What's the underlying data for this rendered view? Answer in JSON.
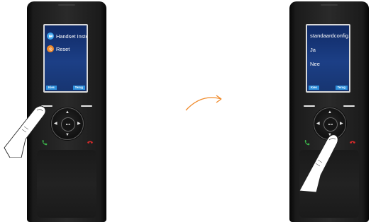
{
  "left_handset": {
    "menu_items": [
      {
        "label": "Handset Instell.",
        "icon": "chat-bubble-icon"
      },
      {
        "label": "Reset",
        "icon": "gear-icon"
      }
    ],
    "softkey_left": "Kies",
    "softkey_right": "Terug"
  },
  "right_handset": {
    "title": "standaardconfig.",
    "options": [
      "Ja",
      "Nee"
    ],
    "softkey_left": "Kies",
    "softkey_right": "Terug"
  },
  "colors": {
    "screen_blue": "#1c3f86",
    "softkey_blue": "#2d8fdc",
    "arrow_orange": "#f08a2a"
  }
}
